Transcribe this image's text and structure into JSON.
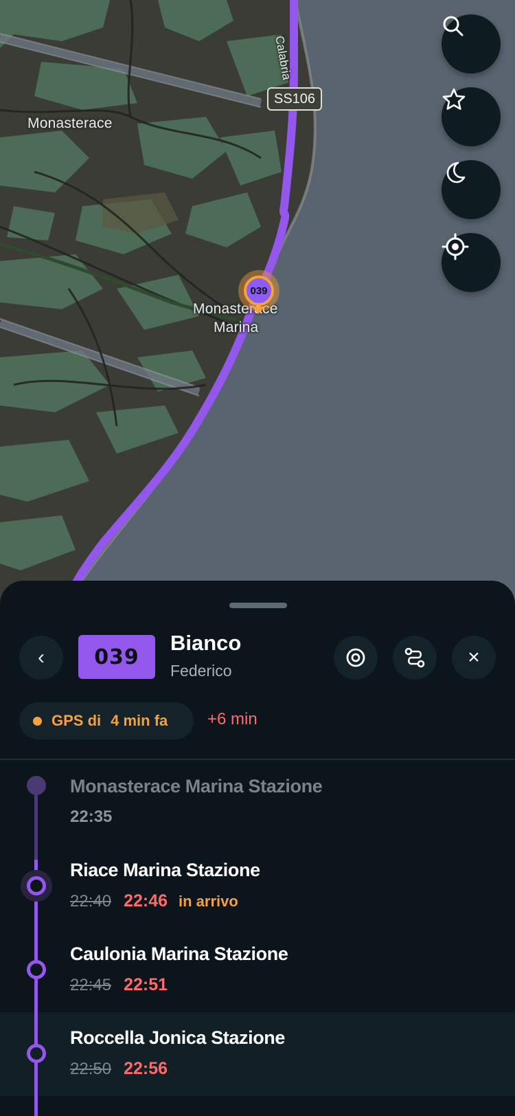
{
  "map": {
    "labels": {
      "town_north": "Monasterace",
      "town_marina_line1": "Monasterace",
      "town_marina_line2": "Marina",
      "road_shield": "SS106",
      "coast_label": "Calabria"
    },
    "bus_marker": {
      "route": "039"
    },
    "controls": {
      "search": "search-icon",
      "favorites": "star-icon",
      "night_mode": "moon-icon",
      "locate": "crosshair-icon"
    },
    "colors": {
      "route_line": "#9457eb",
      "sea": "#5a6470",
      "land_dark": "#3a3c35",
      "land_green": "#4d6c57"
    }
  },
  "sheet": {
    "back_label": "‹",
    "route_number": "039",
    "driver_name": "Bianco",
    "driver_subtitle": "Federico",
    "actions": {
      "focus": "target-icon",
      "route": "route-icon",
      "close": "×"
    },
    "gps": {
      "label": "GPS di",
      "age": "4 min fa"
    },
    "delay": "+6 min",
    "stops": [
      {
        "name": "Monasterace Marina Stazione",
        "time": "22:35",
        "state": "past"
      },
      {
        "name": "Riace Marina Stazione",
        "scheduled": "22:40",
        "expected": "22:46",
        "note": "in arrivo",
        "state": "current"
      },
      {
        "name": "Caulonia Marina Stazione",
        "scheduled": "22:45",
        "expected": "22:51",
        "state": "upcoming"
      },
      {
        "name": "Roccella Jonica Stazione",
        "scheduled": "22:50",
        "expected": "22:56",
        "state": "upcoming"
      }
    ],
    "colors": {
      "accent": "#9457eb",
      "late": "#ff6b6b",
      "gps": "#f6a13d"
    }
  }
}
